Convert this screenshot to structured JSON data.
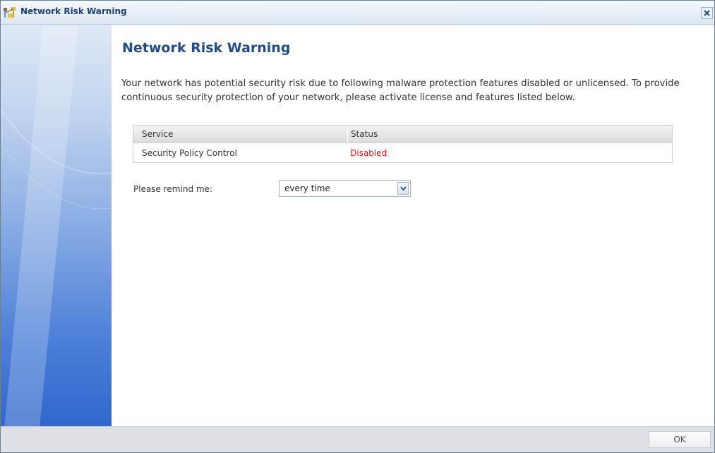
{
  "window": {
    "title": "Network Risk Warning",
    "icon": "network-warning-icon",
    "close_icon": "close-icon"
  },
  "main": {
    "heading": "Network Risk Warning",
    "message": "Your network has potential security risk due to following malware protection features disabled or unlicensed. To provide continuous security protection of your network, please activate license and features listed below."
  },
  "table": {
    "headers": {
      "service": "Service",
      "status": "Status"
    },
    "rows": [
      {
        "service": "Security Policy Control",
        "status": "Disabled"
      }
    ]
  },
  "remind": {
    "label": "Please remind me:",
    "selected": "every time"
  },
  "footer": {
    "ok_label": "OK"
  },
  "colors": {
    "heading": "#1f4b86",
    "status_disabled": "#e4211f",
    "title_text": "#1a3f78"
  }
}
